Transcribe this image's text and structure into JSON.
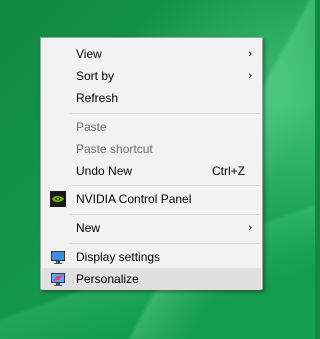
{
  "menu": {
    "items": [
      {
        "label": "View",
        "submenu": true
      },
      {
        "label": "Sort by",
        "submenu": true
      },
      {
        "label": "Refresh"
      },
      {
        "label": "Paste",
        "disabled": true
      },
      {
        "label": "Paste shortcut",
        "disabled": true
      },
      {
        "label": "Undo New",
        "shortcut": "Ctrl+Z"
      },
      {
        "label": "NVIDIA Control Panel",
        "icon": "nvidia-icon"
      },
      {
        "label": "New",
        "submenu": true
      },
      {
        "label": "Display settings",
        "icon": "display-settings-icon"
      },
      {
        "label": "Personalize",
        "icon": "personalize-icon",
        "highlighted": true
      }
    ],
    "submenu_arrow": "›"
  },
  "colors": {
    "desktop": "#0f8a43",
    "menu_bg": "#f2f2f2",
    "highlight": "#e0e0e0",
    "disabled_text": "#6d6d6d",
    "nvidia_green": "#76b900"
  }
}
